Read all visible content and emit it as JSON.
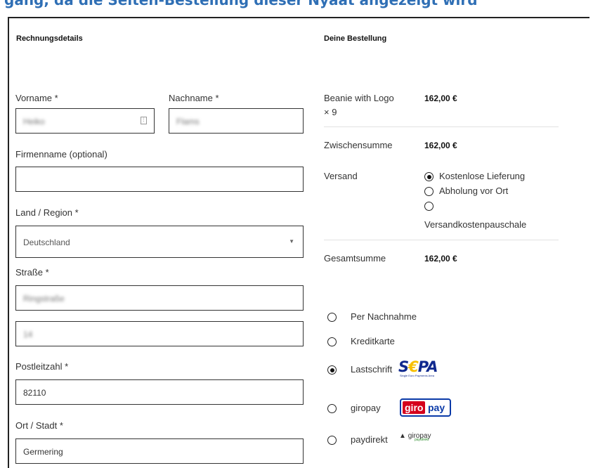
{
  "page": {
    "top_banner_partial": "gang, da die Seiten-Bestellung dieser Nyaat angezeigt wird"
  },
  "billing": {
    "heading": "Rechnungsdetails",
    "first_name": {
      "label": "Vorname *",
      "value": "Heiko"
    },
    "last_name": {
      "label": "Nachname *",
      "value": "Flams"
    },
    "company": {
      "label": "Firmenname (optional)",
      "value": ""
    },
    "country": {
      "label": "Land / Region *",
      "value": "Deutschland"
    },
    "street": {
      "label": "Straße *",
      "value": "Ringstraße",
      "value2": "14"
    },
    "postcode": {
      "label": "Postleitzahl *",
      "value": "82110"
    },
    "city": {
      "label": "Ort / Stadt *",
      "value": "Germering"
    }
  },
  "order": {
    "heading": "Deine Bestellung",
    "product_name": "Beanie with Logo",
    "product_qty": "× 9",
    "product_price": "162,00 €",
    "subtotal_label": "Zwischensumme",
    "subtotal_value": "162,00 €",
    "shipping_label": "Versand",
    "shipping_options": [
      {
        "label": "Kostenlose Lieferung",
        "checked": true
      },
      {
        "label": "Abholung vor Ort",
        "checked": false
      },
      {
        "label": "Versandkostenpauschale",
        "checked": false
      }
    ],
    "total_label": "Gesamtsumme",
    "total_value": "162,00 €"
  },
  "payment": {
    "methods": [
      {
        "label": "Per Nachnahme",
        "checked": false
      },
      {
        "label": "Kreditkarte",
        "checked": false
      },
      {
        "label": "Lastschrift",
        "checked": true
      },
      {
        "label": "giropay",
        "checked": false
      },
      {
        "label": "paydirekt",
        "checked": false
      }
    ],
    "sepa_logo": {
      "main_left": "S",
      "main_euro": "€",
      "main_right": "PA",
      "tagline": "Single Euro Payments Area"
    },
    "giropay_logo": {
      "left": "giro",
      "right": "pay"
    },
    "paydirekt_logo": {
      "main": "giropay",
      "sub": "paydirekt"
    }
  },
  "colors": {
    "banner_text": "#2f6fb5",
    "sepa_blue": "#10298e",
    "sepa_yellow": "#f7c000",
    "giro_red": "#d5001c",
    "giro_blue": "#0a3aa8"
  }
}
